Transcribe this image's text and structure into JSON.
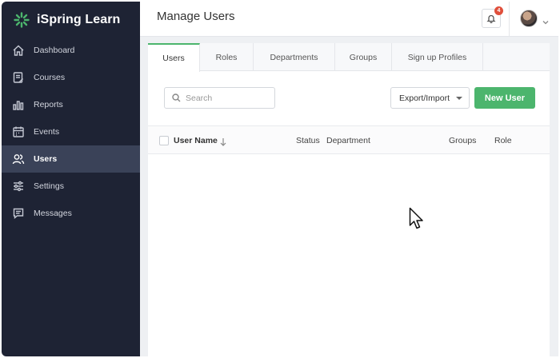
{
  "app": {
    "brand": "iSpring Learn",
    "brand_color": "#4cb56d"
  },
  "sidebar": {
    "items": [
      {
        "label": "Dashboard",
        "icon": "home-icon"
      },
      {
        "label": "Courses",
        "icon": "courses-icon"
      },
      {
        "label": "Reports",
        "icon": "reports-icon"
      },
      {
        "label": "Events",
        "icon": "calendar-icon"
      },
      {
        "label": "Users",
        "icon": "users-icon",
        "active": true
      },
      {
        "label": "Settings",
        "icon": "sliders-icon"
      },
      {
        "label": "Messages",
        "icon": "message-icon"
      }
    ]
  },
  "header": {
    "title": "Manage Users",
    "notifications_count": "4"
  },
  "tabs": [
    {
      "label": "Users",
      "active": true
    },
    {
      "label": "Roles"
    },
    {
      "label": "Departments"
    },
    {
      "label": "Groups"
    },
    {
      "label": "Sign up Profiles"
    }
  ],
  "toolbar": {
    "search_placeholder": "Search",
    "export_label": "Export/Import",
    "new_user_label": "New User"
  },
  "table": {
    "columns": [
      "User Name",
      "Status",
      "Department",
      "Groups",
      "Role"
    ],
    "rows": []
  }
}
